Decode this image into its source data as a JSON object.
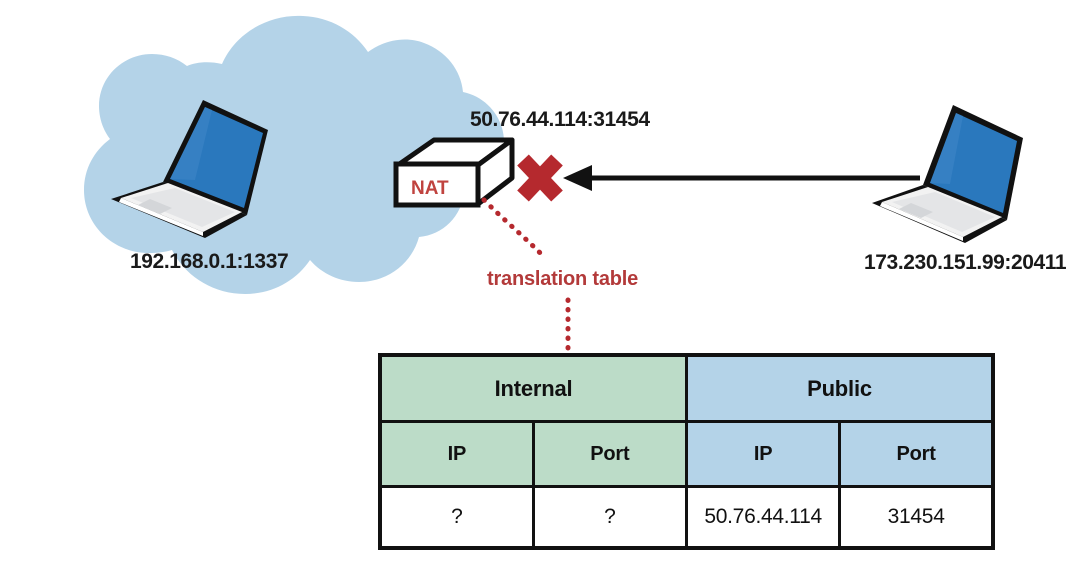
{
  "diagram": {
    "title": "NAT translation table",
    "colors": {
      "cloud": "#b4d3e8",
      "laptop_screen": "#2a78bd",
      "laptop_body": "#ffffff",
      "outline": "#111111",
      "red_accent": "#b5292e",
      "nat_text": "#c0433f",
      "translation_label": "#b33a3a",
      "table_green": "#bcdcc8",
      "table_blue": "#b4d3e8"
    }
  },
  "nodes": {
    "internal_host": {
      "icon": "laptop-icon",
      "label": "192.168.0.1:1337"
    },
    "external_host": {
      "icon": "laptop-icon",
      "label": "173.230.151.99:20411"
    },
    "nat_device": {
      "icon": "nat-box-icon",
      "box_label": "NAT",
      "public_endpoint_label": "50.76.44.114:31454"
    },
    "cloud": {
      "icon": "cloud-icon"
    },
    "blocked_marker": {
      "icon": "red-x-icon"
    },
    "connection": {
      "icon": "arrow-left-icon",
      "direction": "external-to-nat"
    },
    "callout": {
      "icon": "dotted-leader-icon",
      "label": "translation table"
    }
  },
  "table": {
    "group_headers": [
      {
        "label": "Internal",
        "span": 2,
        "tone": "green"
      },
      {
        "label": "Public",
        "span": 2,
        "tone": "blue"
      }
    ],
    "column_headers": [
      {
        "label": "IP",
        "tone": "green"
      },
      {
        "label": "Port",
        "tone": "green"
      },
      {
        "label": "IP",
        "tone": "blue"
      },
      {
        "label": "Port",
        "tone": "blue"
      }
    ],
    "rows": [
      {
        "internal_ip": "?",
        "internal_port": "?",
        "public_ip": "50.76.44.114",
        "public_port": "31454"
      }
    ]
  }
}
